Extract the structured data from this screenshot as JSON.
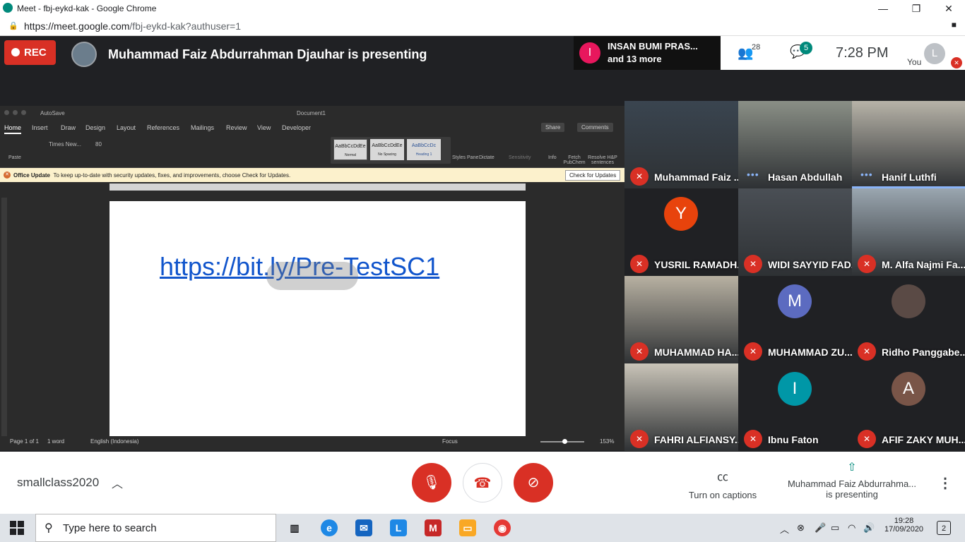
{
  "browser": {
    "window_title": "Meet - fbj-eykd-kak - Google Chrome",
    "url_host": "https://meet.google.com",
    "url_path": "/fbj-eykd-kak?authuser=1",
    "minimize": "—",
    "maximize": "❐",
    "close": "✕"
  },
  "meet_header": {
    "rec_label": "REC",
    "presenter_text": "Muhammad Faiz Abdurrahman Djauhar is presenting",
    "notification": {
      "avatar_letter": "I",
      "line1": "INSAN BUMI PRAS...",
      "line2": "and 13 more"
    },
    "people_count": "28",
    "chat_count": "5",
    "time": "7:28  PM",
    "self_label": "You",
    "self_avatar_letter": "L"
  },
  "shared_screen": {
    "autosave_label": "AutoSave",
    "doc_title": "Document1",
    "ribbon_tabs": [
      "Home",
      "Insert",
      "Draw",
      "Design",
      "Layout",
      "References",
      "Mailings",
      "Review",
      "View",
      "Developer"
    ],
    "share_label": "Share",
    "comments_label": "Comments",
    "font_name": "Times New...",
    "font_size": "80",
    "styles": [
      {
        "preview": "AaBbCcDdEe",
        "name": "Normal"
      },
      {
        "preview": "AaBbCcDdEe",
        "name": "No Spacing"
      },
      {
        "preview": "AaBbCcDc",
        "name": "Heading 1"
      }
    ],
    "ribbon_buttons": [
      "Styles Pane",
      "Dictate",
      "Sensitivity",
      "Info",
      "Fetch PubChem",
      "Resolve H&P sentences"
    ],
    "paste_label": "Paste",
    "update_title": "Office Update",
    "update_message": "To keep up-to-date with security updates, fixes, and improvements, choose Check for Updates.",
    "update_button": "Check for Updates",
    "document_link": "https://bit.ly/Pre-TestSC1",
    "status": {
      "page": "Page 1 of 1",
      "words": "1 word",
      "language": "English (Indonesia)",
      "focus": "Focus",
      "zoom": "153%"
    }
  },
  "participants": [
    {
      "name": "Muhammad Faiz ...",
      "muted": true,
      "video": true,
      "tone": "#3a4550"
    },
    {
      "name": "Hasan Abdullah",
      "muted": false,
      "video": true,
      "tone": "#8a8f86"
    },
    {
      "name": "Hanif Luthfi",
      "muted": false,
      "video": true,
      "tone": "#b7b3a8",
      "speaking": true
    },
    {
      "name": "YUSRIL RAMADH...",
      "muted": true,
      "video": false,
      "avatar": "Y",
      "color": "#e8430c"
    },
    {
      "name": "WIDI SAYYID FAD...",
      "muted": true,
      "video": true,
      "tone": "#4a4f55"
    },
    {
      "name": "M. Alfa Najmi Fa...",
      "muted": true,
      "video": true,
      "tone": "#9aa6b0"
    },
    {
      "name": "MUHAMMAD HA...",
      "muted": true,
      "video": true,
      "tone": "#b8b1a2"
    },
    {
      "name": "MUHAMMAD ZU...",
      "muted": true,
      "video": false,
      "avatar": "M",
      "color": "#5c6bc0"
    },
    {
      "name": "Ridho Panggabe...",
      "muted": true,
      "video": false,
      "avatar": "",
      "color": "#5a4a45"
    },
    {
      "name": "FAHRI ALFIANSY...",
      "muted": true,
      "video": true,
      "tone": "#c9c4b8"
    },
    {
      "name": "Ibnu Faton",
      "muted": true,
      "video": false,
      "avatar": "I",
      "color": "#0097a7"
    },
    {
      "name": "AFIF ZAKY MUH...",
      "muted": true,
      "video": false,
      "avatar": "A",
      "color": "#795548"
    }
  ],
  "bottom_bar": {
    "meeting_name": "smallclass2020",
    "captions_label": "Turn on captions",
    "presenter_line1": "Muhammad Faiz Abdurrahma...",
    "presenter_line2": "is presenting"
  },
  "taskbar": {
    "search_placeholder": "Type here to search",
    "time": "19:28",
    "date": "17/09/2020",
    "notif_count": "2"
  }
}
